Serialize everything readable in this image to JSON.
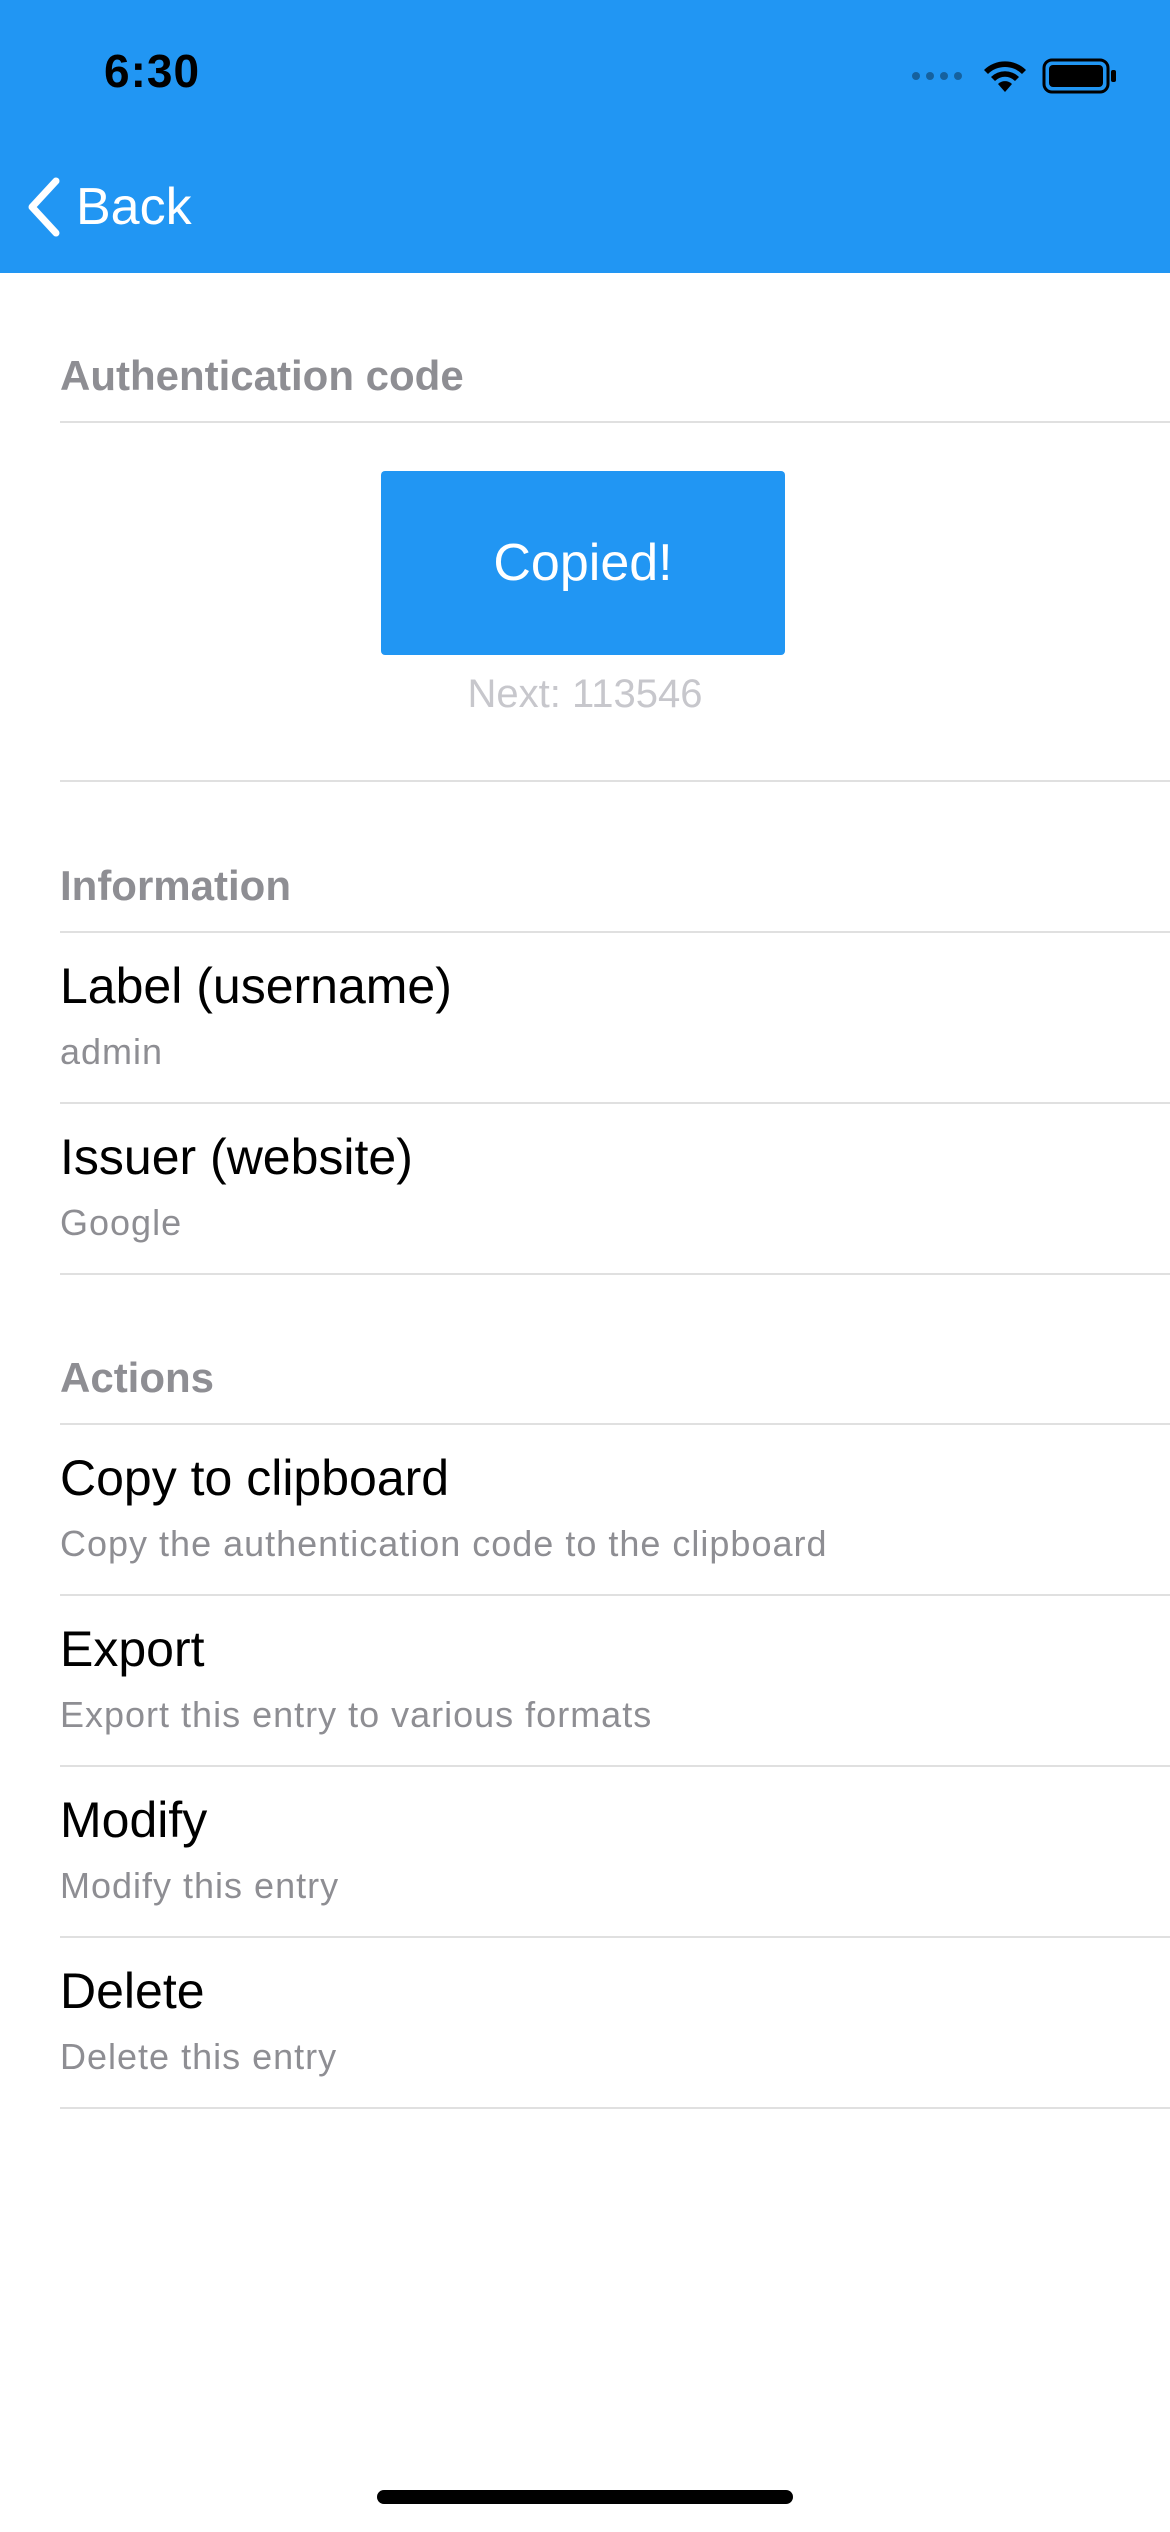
{
  "status_bar": {
    "time": "6:30",
    "wifi_icon": "wifi-icon",
    "battery_icon": "battery-icon"
  },
  "nav": {
    "back_label": "Back",
    "back_icon": "chevron-left-icon"
  },
  "auth": {
    "section_title": "Authentication code",
    "button_label": "Copied!",
    "next_code": "Next: 113546"
  },
  "information": {
    "section_title": "Information",
    "items": [
      {
        "title": "Label (username)",
        "subtitle": "admin"
      },
      {
        "title": "Issuer (website)",
        "subtitle": "Google"
      }
    ]
  },
  "actions": {
    "section_title": "Actions",
    "items": [
      {
        "title": "Copy to clipboard",
        "subtitle": "Copy the authentication code to the clipboard"
      },
      {
        "title": "Export",
        "subtitle": "Export this entry to various formats"
      },
      {
        "title": "Modify",
        "subtitle": "Modify this entry"
      },
      {
        "title": "Delete",
        "subtitle": "Delete this entry"
      }
    ]
  },
  "colors": {
    "accent": "#2196F3",
    "section_header": "#8e8e93",
    "subtitle": "#8e8e93",
    "next_code": "#c7c7cc",
    "divider": "#e0e0e0"
  }
}
